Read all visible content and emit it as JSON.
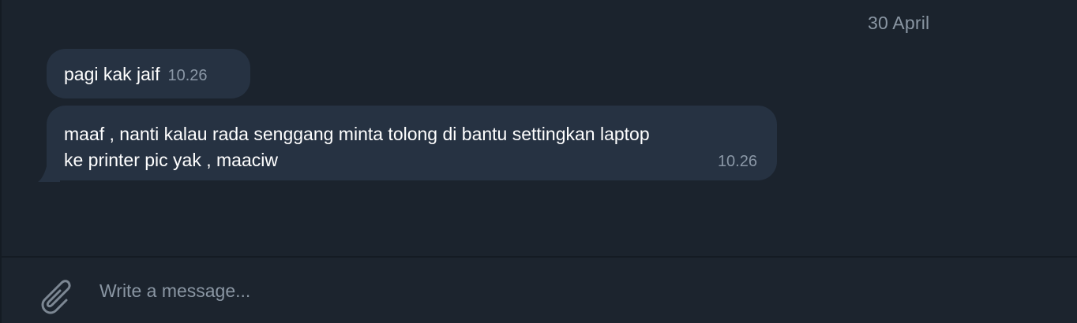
{
  "chat": {
    "date_label": "30 April",
    "messages": [
      {
        "lines": [
          "pagi kak jaif"
        ],
        "time": "10.26"
      },
      {
        "lines": [
          "maaf , nanti kalau rada senggang minta tolong di bantu settingkan laptop",
          "ke printer pic yak , maaciw"
        ],
        "time": "10.26"
      }
    ]
  },
  "composer": {
    "placeholder": "Write a message...",
    "value": "",
    "attach_icon": "paperclip-icon"
  },
  "colors": {
    "background": "#1b232d",
    "bubble": "#263242",
    "muted_text": "#8a96a3",
    "text": "#ffffff"
  }
}
